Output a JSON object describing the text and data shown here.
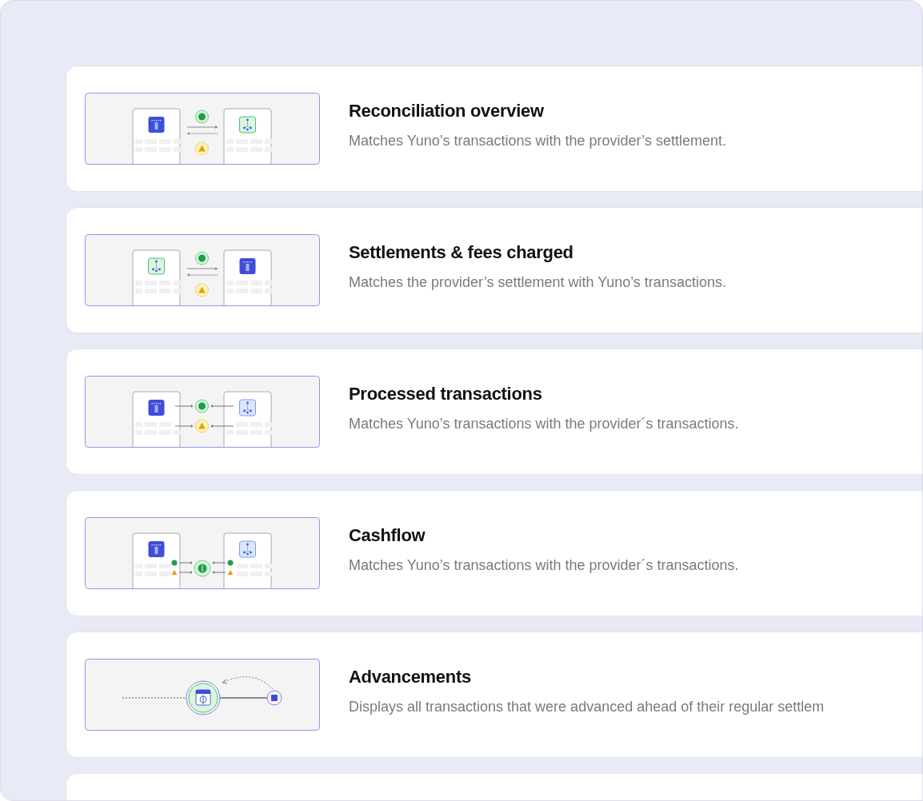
{
  "reports": [
    {
      "kind": "overview",
      "title": "Reconciliation overview",
      "description": "Matches Yuno’s transactions with the provider’s settlement."
    },
    {
      "kind": "settlements",
      "title": "Settlements & fees charged",
      "description": "Matches the provider’s settlement with Yuno’s transactions."
    },
    {
      "kind": "processed",
      "title": "Processed transactions",
      "description": "Matches Yuno’s transactions with the provider´s transactions."
    },
    {
      "kind": "cashflow",
      "title": "Cashflow",
      "description": "Matches Yuno’s transactions with the provider´s transactions."
    },
    {
      "kind": "advancements",
      "title": "Advancements",
      "description": "Displays all transactions that were advanced ahead of their regular settlem"
    }
  ]
}
